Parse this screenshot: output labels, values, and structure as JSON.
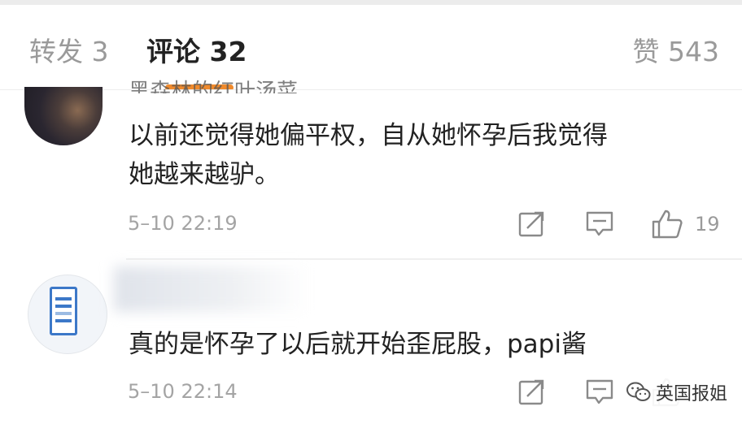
{
  "tabs": {
    "repost": "转发 3",
    "comments": "评论 32",
    "likes": "赞 543",
    "active": "comments",
    "indicator_color": "#f08a2c"
  },
  "comments": [
    {
      "username": "黑森林的红叶汤菜",
      "text": "以前还觉得她偏平权，自从她怀孕后我觉得\n她越来越驴。",
      "time": "5–10 22:19",
      "likes": "19",
      "icons": [
        "share-icon",
        "reply-icon",
        "thumbs-up-icon"
      ]
    },
    {
      "username": "",
      "text": "真的是怀孕了以后就开始歪屁股，papi酱",
      "time": "5–10 22:14",
      "likes": "",
      "icons": [
        "share-icon",
        "reply-icon",
        "thumbs-up-icon"
      ]
    }
  ],
  "watermark": {
    "text": "英国报姐",
    "icon": "wechat-icon"
  }
}
